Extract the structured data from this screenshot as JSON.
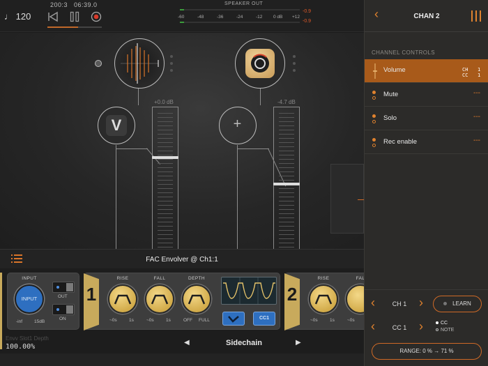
{
  "transport": {
    "tempo": "♩ 120",
    "bar_position": "200:3",
    "time": "06:39.0",
    "speaker_out_label": "SPEAKER OUT",
    "db_ticks": [
      "-60",
      "-48",
      "-36",
      "-24",
      "-12",
      "0 dB",
      "+12"
    ],
    "peak_top": "-0.9",
    "peak_bottom": "-0.9",
    "rewind_icon": "rewind-icon",
    "pause_icon": "pause-icon",
    "record_icon": "record-icon"
  },
  "mixer": {
    "channel1": {
      "fader_db": "+0.0 dB",
      "fader_level": 0.5
    },
    "channel2": {
      "fader_db": "-4.7 dB",
      "fader_level": 0.44
    }
  },
  "plugin": {
    "title": "FAC Envolver @ Ch1:1",
    "input_label": "INPUT",
    "input_knob_label": "INPUT",
    "input_min": "-inf",
    "input_max": "15dB",
    "out_label": "OUT",
    "on_label": "ON",
    "env1_tag": "1",
    "env2_tag": "2",
    "rise_label": "RISE",
    "fall_label": "FALL",
    "depth_label": "DEPTH",
    "rise_min": "~0s",
    "rise_max": "1s",
    "fall_min": "~0s",
    "fall_max": "1s",
    "depth_min": "OFF",
    "depth_max": "FULL",
    "env2_rise_label": "RISE",
    "env2_fall_label": "FAL",
    "env2_rise_min": "~0s",
    "env2_rise_max": "1s",
    "env2_fall_min": "~0s",
    "cc_button": "CC1",
    "param_name": "Envv Slot1 Depth",
    "param_value": "100.00%",
    "page_name": "Sidechain"
  },
  "right_panel": {
    "title": "CHAN 2",
    "section_header": "CHANNEL CONTROLS",
    "controls": [
      {
        "label": "Volume",
        "ch_label": "CH",
        "ch_value": "1",
        "cc_label": "CC",
        "cc_value": "1",
        "selected": true
      },
      {
        "label": "Mute",
        "value": "---"
      },
      {
        "label": "Solo",
        "value": "---"
      },
      {
        "label": "Rec enable",
        "value": "---"
      }
    ],
    "channel": "CH 1",
    "learn": "LEARN",
    "cc": "CC 1",
    "opt_cc": "CC",
    "opt_note": "NOTE",
    "range": "RANGE: 0 % → 71 %"
  },
  "colors": {
    "accent": "#e0822e",
    "selected_row": "#a85a1a",
    "knob_yellow": "#d2ab4a",
    "tag_gold": "#c8aa5c",
    "blue": "#2e6fc0"
  }
}
